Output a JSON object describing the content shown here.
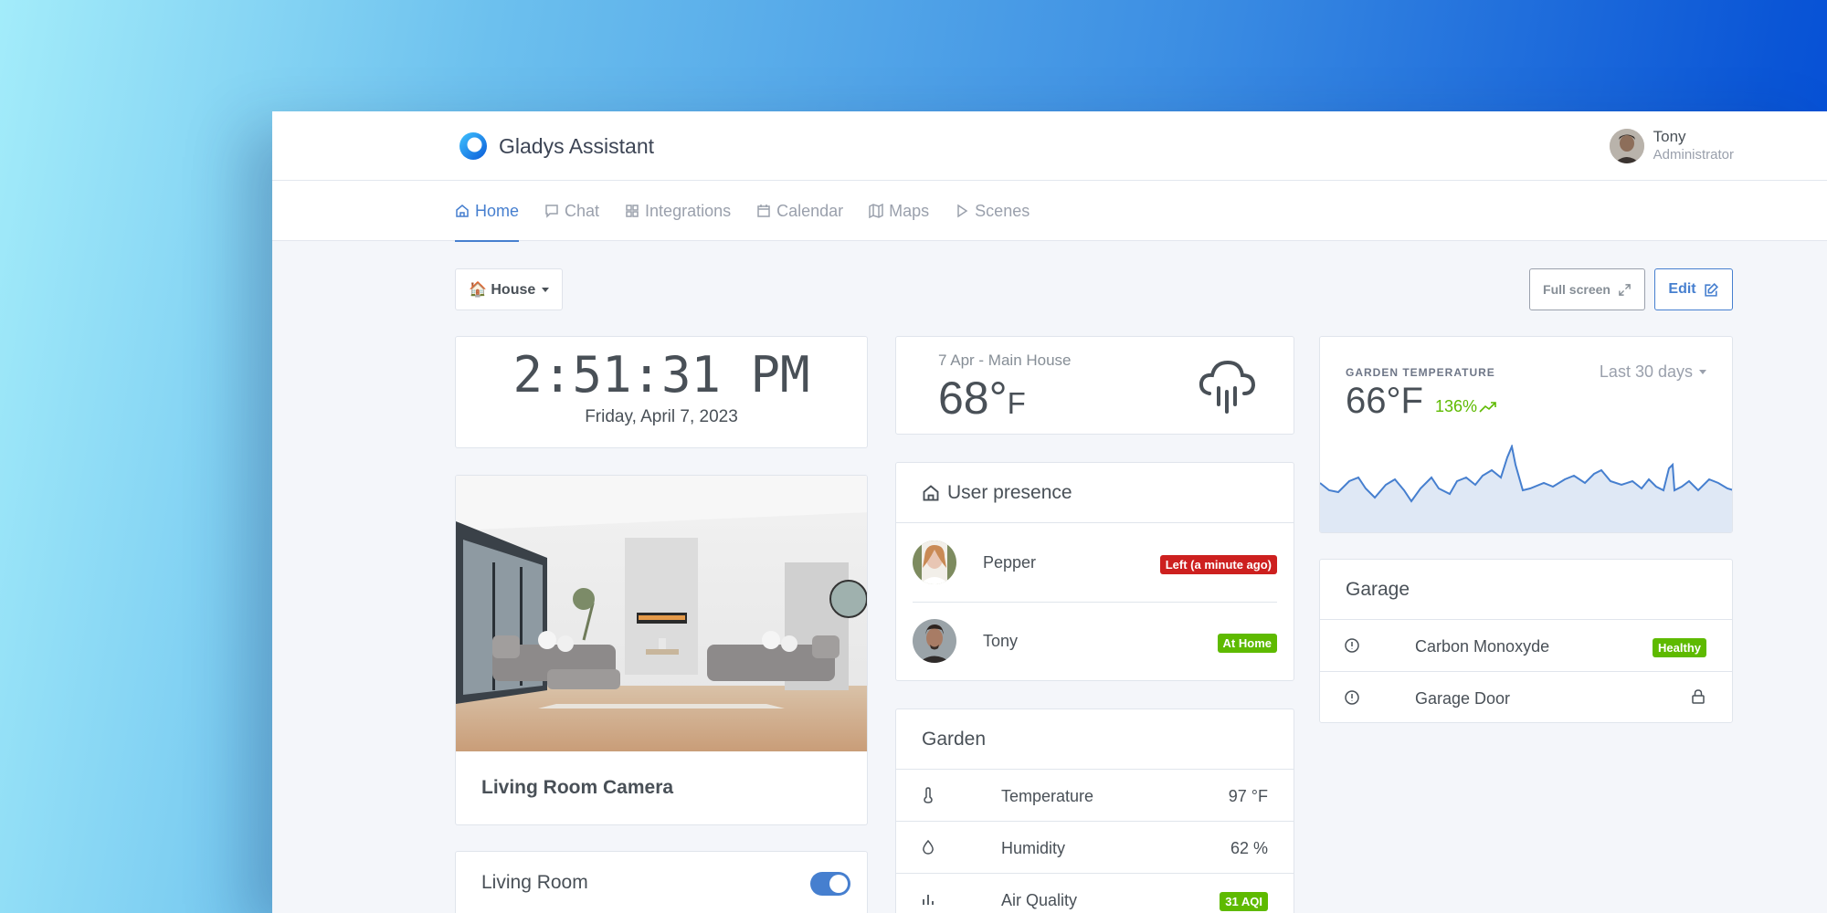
{
  "app": {
    "title": "Gladys Assistant"
  },
  "user": {
    "name": "Tony",
    "role": "Administrator"
  },
  "nav": [
    {
      "label": "Home",
      "icon": "home-icon",
      "active": true
    },
    {
      "label": "Chat",
      "icon": "chat-icon"
    },
    {
      "label": "Integrations",
      "icon": "grid-icon"
    },
    {
      "label": "Calendar",
      "icon": "calendar-icon"
    },
    {
      "label": "Maps",
      "icon": "map-icon"
    },
    {
      "label": "Scenes",
      "icon": "play-icon"
    }
  ],
  "toolbar": {
    "house_label": "🏠 House",
    "fullscreen_label": "Full screen",
    "edit_label": "Edit"
  },
  "clock": {
    "time": "2:51:31 PM",
    "date": "Friday, April 7, 2023"
  },
  "camera": {
    "title": "Living Room Camera"
  },
  "living_room": {
    "title": "Living Room",
    "toggle_on": true
  },
  "weather": {
    "date": "7 Apr - Main House",
    "temp": "68°",
    "unit": "F",
    "icon": "rain-cloud-icon"
  },
  "presence": {
    "title": "User presence",
    "users": [
      {
        "name": "Pepper",
        "status": "Left (a minute ago)",
        "color": "#cd201f"
      },
      {
        "name": "Tony",
        "status": "At Home",
        "color": "#5eba00"
      }
    ]
  },
  "garden": {
    "title": "Garden",
    "rows": [
      {
        "label": "Temperature",
        "value": "97 °F",
        "icon": "thermometer-icon"
      },
      {
        "label": "Humidity",
        "value": "62 %",
        "icon": "droplet-icon"
      },
      {
        "label": "Air Quality",
        "value": "31 AQI",
        "icon": "bar-chart-icon"
      }
    ]
  },
  "garden_temp": {
    "label": "GARDEN TEMPERATURE",
    "range": "Last 30 days",
    "value": "66°F",
    "pct": "136%",
    "accent": "#467fcf"
  },
  "garage": {
    "title": "Garage",
    "rows": [
      {
        "label": "Carbon Monoxyde",
        "value": "Healthy",
        "icon": "info-icon"
      },
      {
        "label": "Garage Door",
        "icon": "info-icon",
        "status_icon": "lock-icon"
      }
    ]
  }
}
